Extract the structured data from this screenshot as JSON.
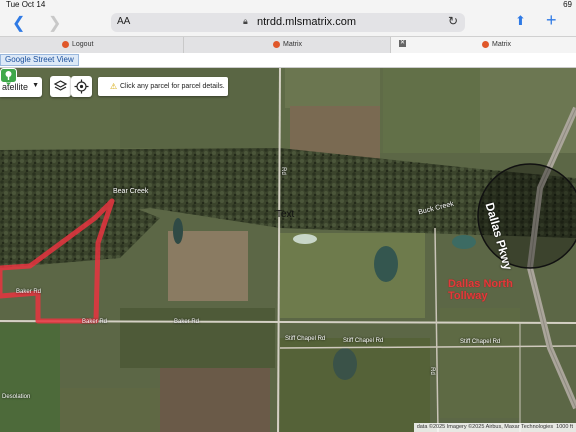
{
  "status_bar": {
    "time": "Tue Oct 14",
    "battery": "69"
  },
  "browser": {
    "text_size_label": "AA",
    "url": "ntrdd.mlsmatrix.com",
    "tabs": [
      {
        "label": "Logout",
        "active": false
      },
      {
        "label": "Matrix",
        "active": false
      },
      {
        "label": "Matrix",
        "active": true
      }
    ]
  },
  "street_view_link": "Google Street View",
  "map": {
    "map_type": "atellite",
    "hint": "Click any parcel for parcel details.",
    "creeks": [
      "Bear Creek",
      "Buck Creek"
    ],
    "roads": [
      "Baker Rd",
      "Baker Rd",
      "Baker Rd",
      "Stiff Chapel Rd",
      "Stiff Chapel Rd",
      "Stiff Chapel Rd",
      "Rd",
      "Rd"
    ],
    "overlay_text": "Text",
    "annotation_line1": "Dallas North",
    "annotation_line2": "Tollway",
    "highway_label": "Dallas Pkwy",
    "edge_label": "Desolation",
    "attribution": "data ©2025 Imagery ©2025 Airbus, Maxar Technologies",
    "scale_label": "1000 ft"
  },
  "colors": {
    "accent": "#2f7ae5",
    "annotation": "#e23a3a",
    "parcel_outline": "#e8343f"
  }
}
